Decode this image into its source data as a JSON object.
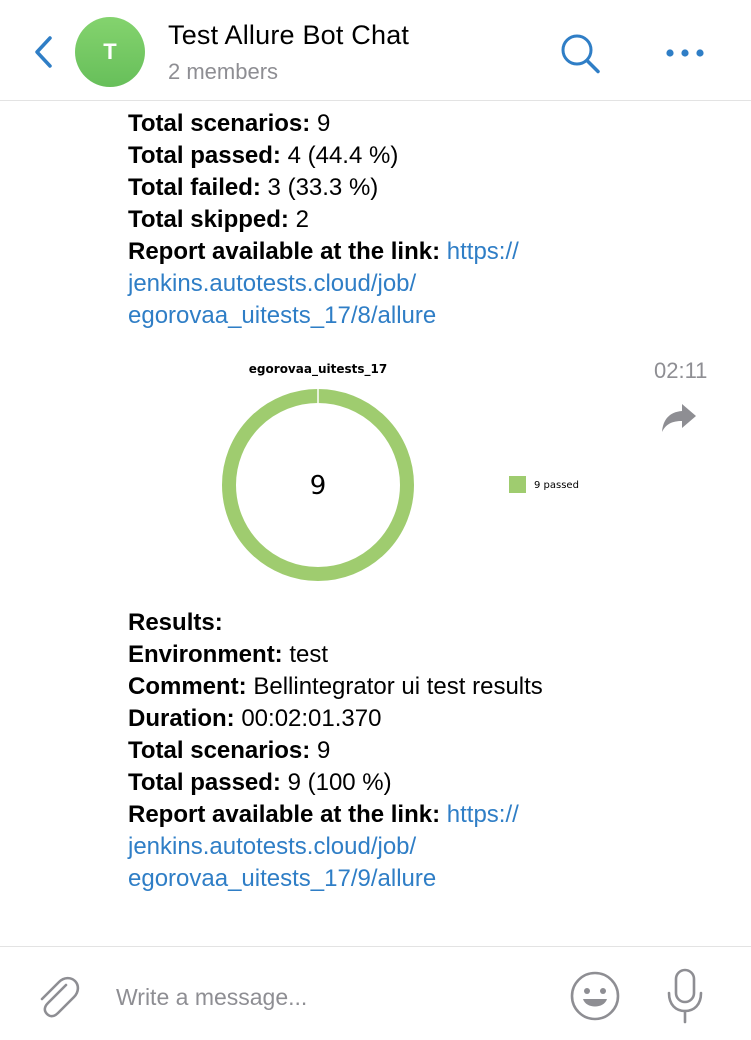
{
  "header": {
    "avatar_letter": "T",
    "title": "Test Allure Bot Chat",
    "subtitle": "2 members",
    "icons": [
      "back-chevron-icon",
      "search-icon",
      "more-icon"
    ]
  },
  "message1": {
    "lines": [
      {
        "label": "Total scenarios:",
        "value": " 9"
      },
      {
        "label": "Total passed:",
        "value": " 4 (44.4 %)"
      },
      {
        "label": "Total failed:",
        "value": " 3 (33.3 %)"
      },
      {
        "label": "Total skipped:",
        "value": " 2"
      }
    ],
    "link_label": "Report available at the link:",
    "link_lines": [
      "https://",
      "jenkins.autotests.cloud/job/",
      "egorovaa_uitests_17/8/allure"
    ]
  },
  "chart_image": {
    "time": "02:11",
    "forward_icon": "forward-icon",
    "chart_data": {
      "type": "pie",
      "variant": "donut",
      "title": "egorovaa_uitests_17",
      "center_label": "9",
      "slices": [
        {
          "name": "9 passed",
          "value": 9,
          "color": "#9fcc6f"
        }
      ],
      "legend_position": "right"
    }
  },
  "message2": {
    "lines": [
      {
        "label": "Results:",
        "value": ""
      },
      {
        "label": "Environment:",
        "value": " test"
      },
      {
        "label": "Comment:",
        "value": " Bellintegrator ui test results"
      },
      {
        "label": "Duration:",
        "value": " 00:02:01.370"
      },
      {
        "label": "Total scenarios:",
        "value": " 9"
      },
      {
        "label": "Total passed:",
        "value": " 9 (100 %)"
      }
    ],
    "link_label": "Report available at the link:",
    "link_lines": [
      "https://",
      "jenkins.autotests.cloud/job/",
      "egorovaa_uitests_17/9/allure"
    ]
  },
  "composer": {
    "placeholder": "Write a message...",
    "icons": [
      "attach-icon",
      "emoji-icon",
      "mic-icon"
    ]
  },
  "colors": {
    "accent": "#2f7ec6",
    "avatar": "#72c862",
    "muted": "#8e8e93",
    "chart_green": "#9fcc6f"
  }
}
